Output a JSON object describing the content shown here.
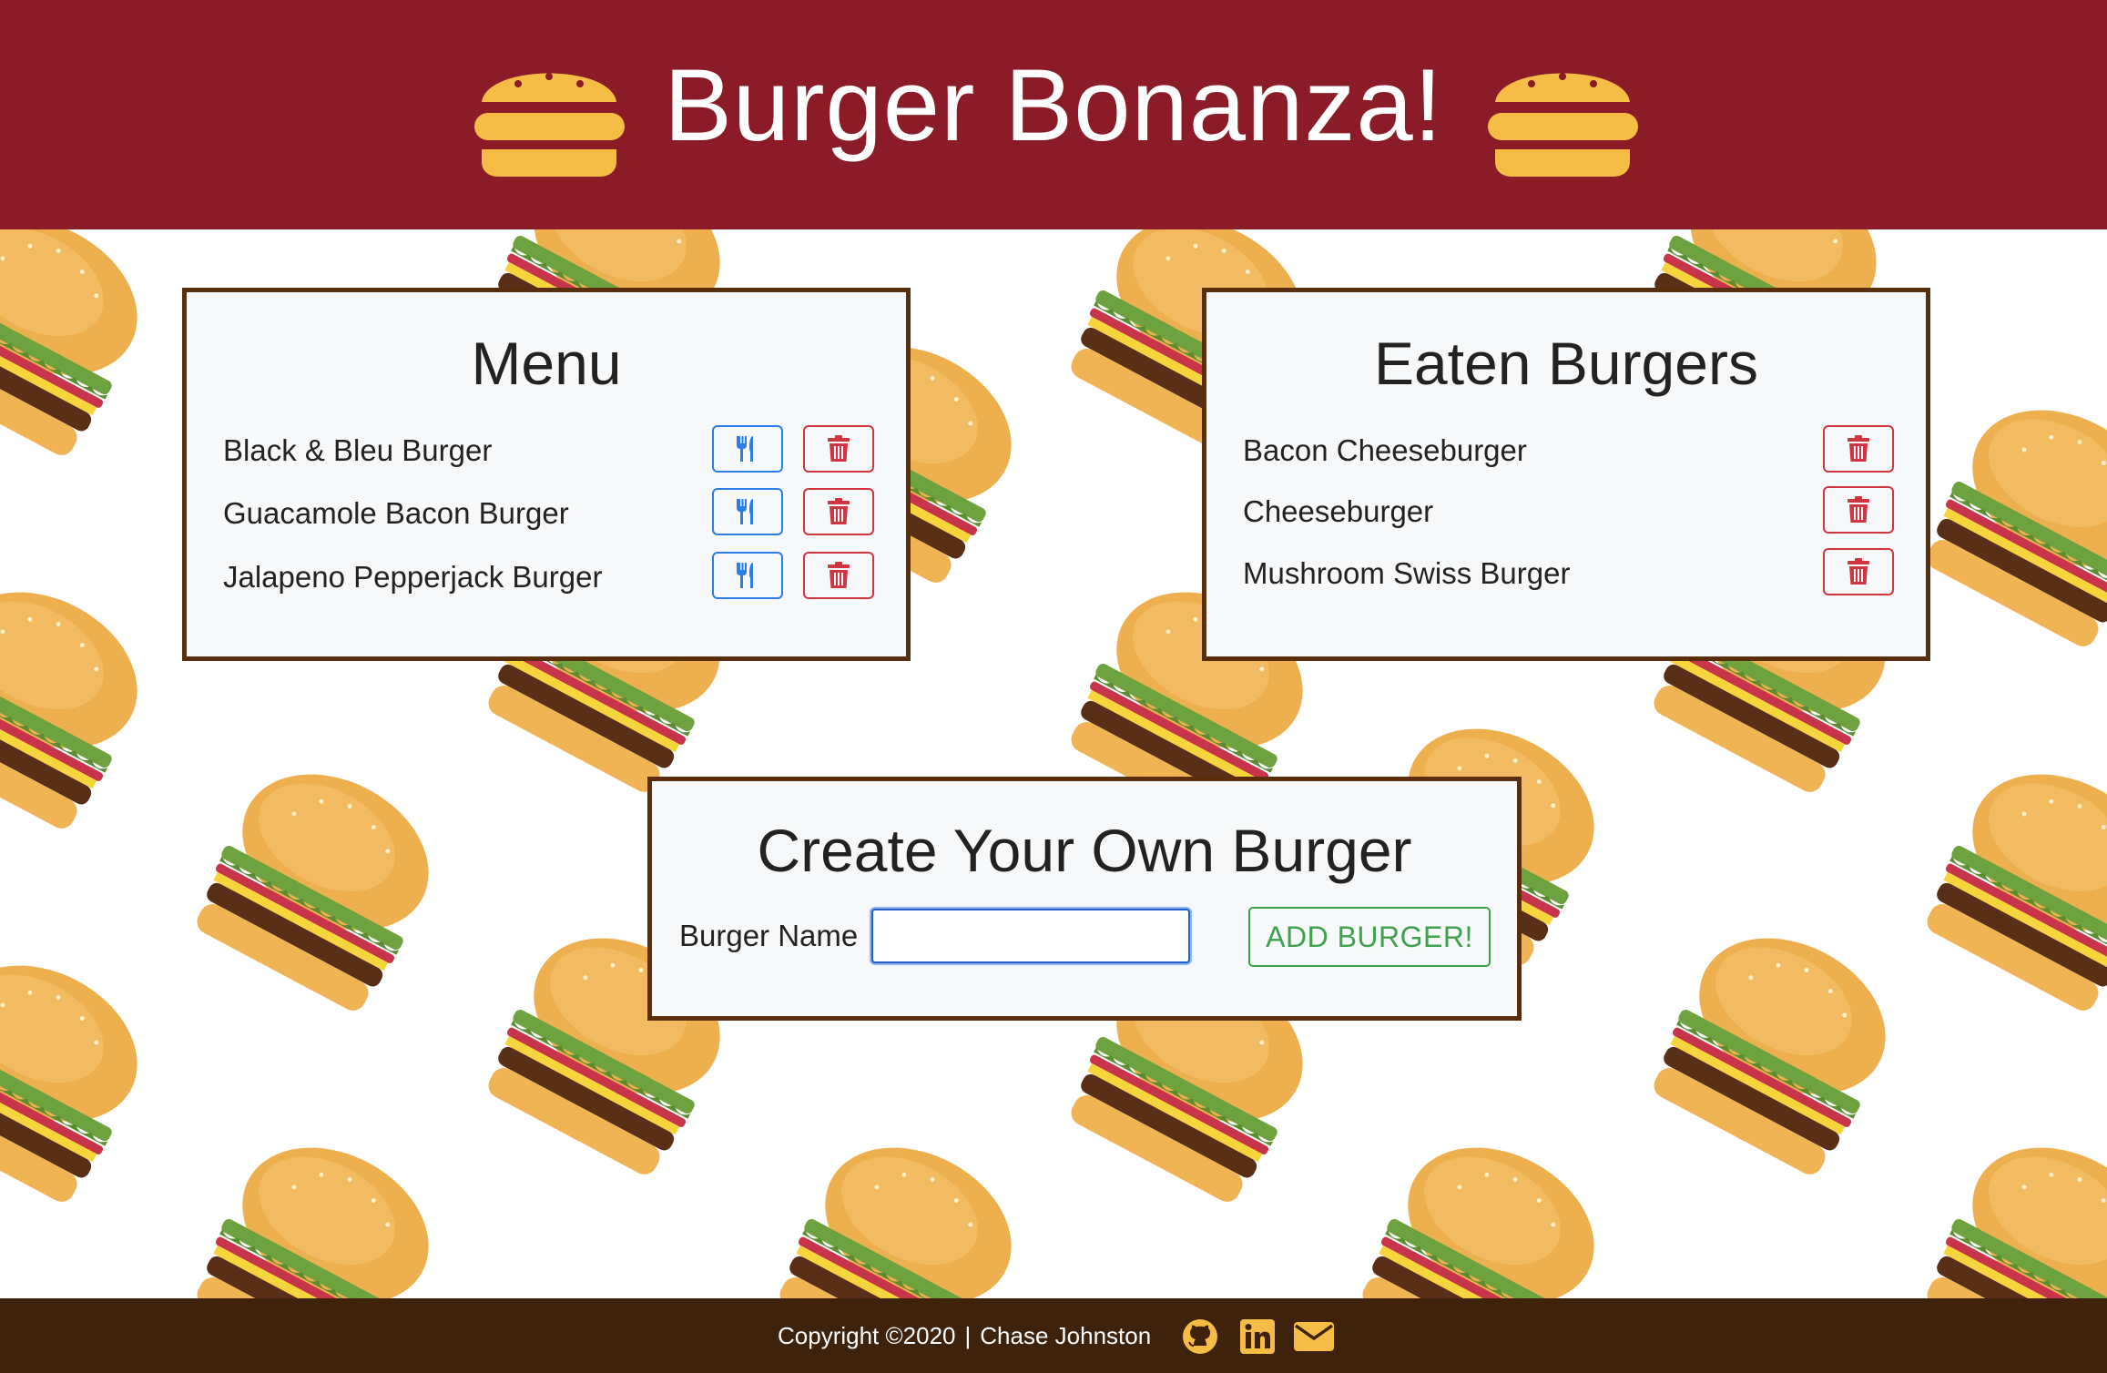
{
  "header": {
    "title": "Burger Bonanza!",
    "icon": "burger-icon",
    "background": "#8a1b27"
  },
  "menu": {
    "title": "Menu",
    "items": [
      {
        "name": "Black & Bleu Burger"
      },
      {
        "name": "Guacamole Bacon Burger"
      },
      {
        "name": "Jalapeno Pepperjack Burger"
      }
    ],
    "eat_icon": "utensils-icon",
    "delete_icon": "trash-icon"
  },
  "eaten": {
    "title": "Eaten Burgers",
    "items": [
      {
        "name": "Bacon Cheeseburger"
      },
      {
        "name": "Cheeseburger"
      },
      {
        "name": "Mushroom Swiss Burger"
      }
    ],
    "delete_icon": "trash-icon"
  },
  "create": {
    "title": "Create Your Own Burger",
    "label": "Burger Name",
    "input_value": "",
    "button_label": "ADD BURGER!"
  },
  "footer": {
    "copyright": "Copyright ©2020",
    "separator": "|",
    "author": "Chase Johnston",
    "icons": [
      "github-icon",
      "linkedin-icon",
      "envelope-icon"
    ],
    "background": "#3e220b"
  },
  "colors": {
    "card_border": "#5a2d0c",
    "eat_button": "#2b7de9",
    "delete_button": "#d0343f",
    "add_button": "#3ea24c",
    "icon_yellow": "#f5bd45"
  }
}
